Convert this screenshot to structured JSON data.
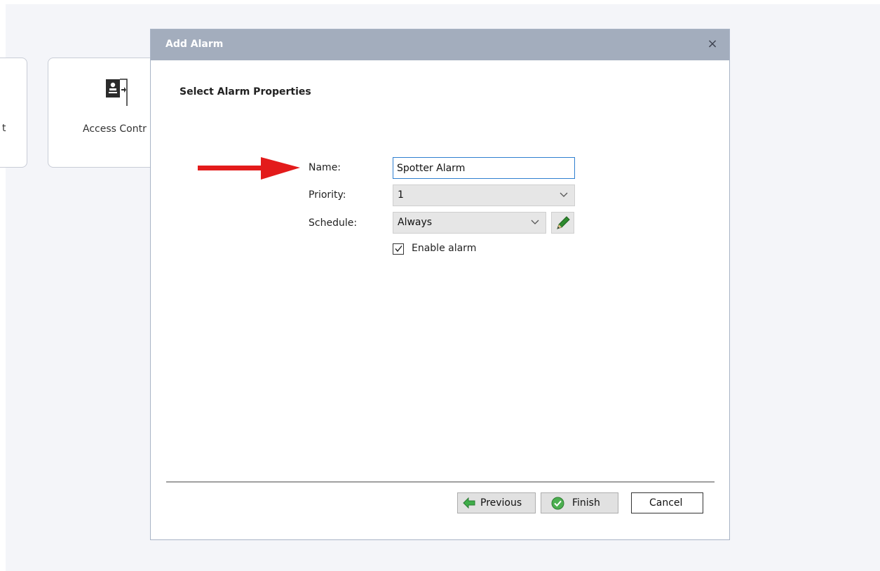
{
  "background": {
    "tile_left_label": "t",
    "tile_access_label": "Access Contr"
  },
  "dialog": {
    "title": "Add Alarm",
    "close_glyph": "×",
    "section_title": "Select Alarm Properties",
    "fields": {
      "name_label": "Name:",
      "name_value": "Spotter Alarm",
      "priority_label": "Priority:",
      "priority_value": "1",
      "schedule_label": "Schedule:",
      "schedule_value": "Always",
      "enable_label": "Enable alarm",
      "enable_checked": true
    },
    "buttons": {
      "previous": "Previous",
      "finish": "Finish",
      "cancel": "Cancel"
    }
  },
  "icons": {
    "access": "access-control-icon",
    "edit": "pencil-icon",
    "previous": "green-left-arrow-icon",
    "finish": "green-check-icon",
    "annotation": "red-arrow"
  },
  "colors": {
    "titlebar": "#a3adbd",
    "input_focus": "#2f7fd0",
    "annotation_arrow": "#e31b1b",
    "success_green": "#4caf50"
  }
}
